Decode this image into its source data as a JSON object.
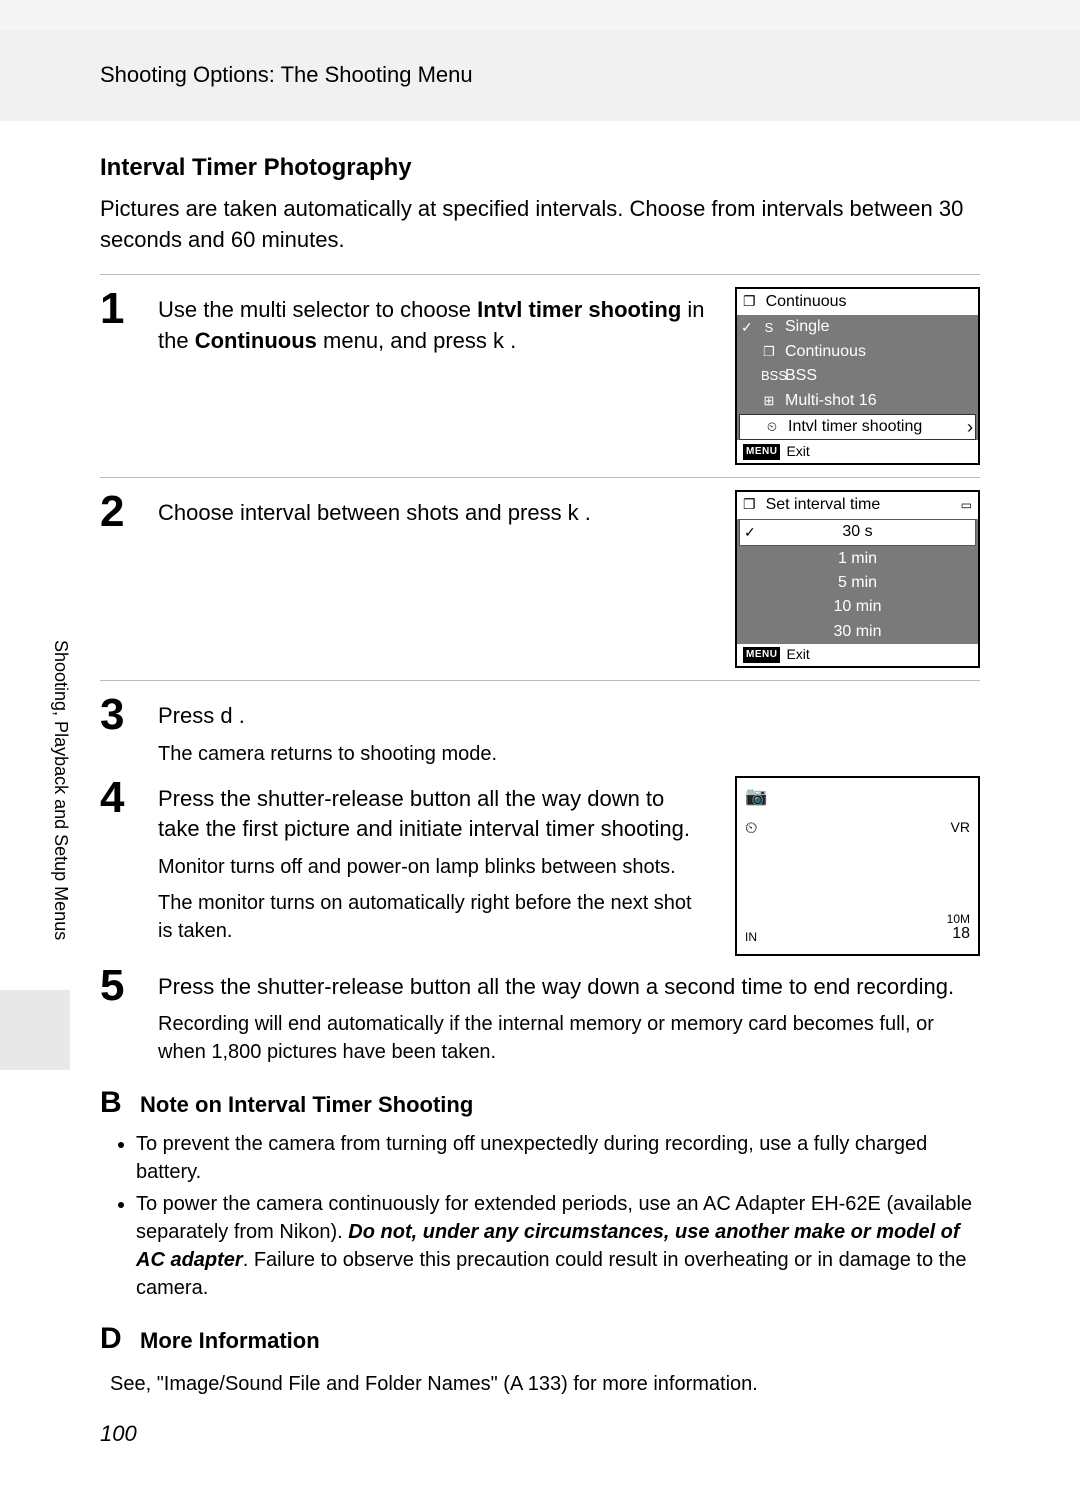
{
  "header": {
    "breadcrumb": "Shooting Options: The Shooting Menu"
  },
  "section_title": "Interval Timer Photography",
  "intro": "Pictures are taken automatically at specified intervals. Choose from intervals between 30 seconds and 60 minutes.",
  "sidebar_label": "Shooting, Playback and Setup Menus",
  "page_number": "100",
  "steps": {
    "s1": {
      "num": "1",
      "text_a": "Use the multi selector to choose ",
      "text_b": "Intvl timer shooting",
      "text_c": " in the ",
      "text_d": "Continuous",
      "text_e": " menu, and press k   ."
    },
    "s2": {
      "num": "2",
      "text": "Choose interval between shots and press k   ."
    },
    "s3": {
      "num": "3",
      "text": "Press d   .",
      "note": "The camera returns to shooting mode."
    },
    "s4": {
      "num": "4",
      "text": "Press the shutter-release button all the way down to take the first picture and initiate interval timer shooting.",
      "note1": "Monitor turns off and power-on lamp blinks between shots.",
      "note2": "The monitor turns on automatically right before the next shot is taken."
    },
    "s5": {
      "num": "5",
      "text": "Press the shutter-release button all the way down a second time to end recording.",
      "note": "Recording will end automatically if the internal memory or memory card becomes full, or when 1,800 pictures have been taken."
    }
  },
  "lcd1": {
    "title": "Continuous",
    "items": [
      {
        "icon": "S",
        "label": "Single",
        "checked": true
      },
      {
        "icon": "❐",
        "label": "Continuous"
      },
      {
        "icon": "BSS",
        "label": "BSS"
      },
      {
        "icon": "⊞",
        "label": "Multi-shot 16"
      },
      {
        "icon": "⏲",
        "label": "Intvl timer shooting",
        "selected": true
      }
    ],
    "footer_badge": "MENU",
    "footer_text": "Exit"
  },
  "lcd2": {
    "title": "Set interval time",
    "items": [
      {
        "label": "30 s",
        "selected": true,
        "checked": true
      },
      {
        "label": "1 min"
      },
      {
        "label": "5 min"
      },
      {
        "label": "10 min"
      },
      {
        "label": "30 min"
      }
    ],
    "footer_badge": "MENU",
    "footer_text": "Exit"
  },
  "lcd_live": {
    "tl": "📷",
    "ml": "⏲",
    "mr": "VR",
    "bl": "IN",
    "br1": "10M",
    "br2": "18"
  },
  "callout_note": {
    "icon": "B",
    "title": "Note on Interval Timer Shooting",
    "b1": "To prevent the camera from turning off unexpectedly during recording, use a fully charged battery.",
    "b2a": "To power the camera continuously for extended periods, use an AC Adapter EH-62E (available separately from Nikon). ",
    "b2b": "Do not, under any circumstances, use another make or model of AC adapter",
    "b2c": ". Failure to observe this precaution could result in overheating or in damage to the camera."
  },
  "callout_more": {
    "icon": "D",
    "title": "More Information",
    "text_a": "See, \"Image/Sound File and Folder Names\" (A",
    "text_b": "   133) for more information."
  }
}
